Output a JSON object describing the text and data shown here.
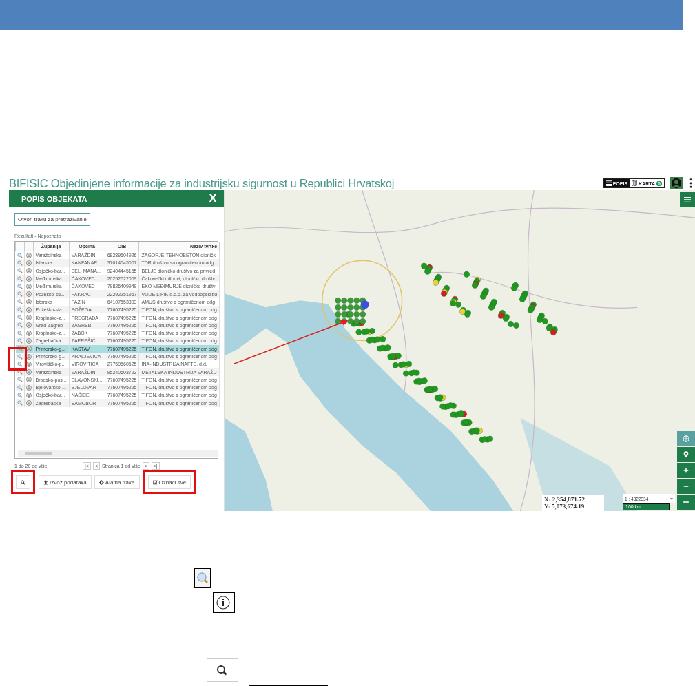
{
  "app": {
    "title": "BIFISIC Objedinjene informacije za industrijsku sigurnost u Republici Hrvatskoj",
    "view_toggle": [
      {
        "label": "POPIS",
        "selected": true
      },
      {
        "label": "KARTA",
        "selected": false,
        "badge": "0"
      }
    ]
  },
  "panel": {
    "title": "POPIS OBJEKATA",
    "close": "X",
    "search_toggle": "Otvori traku za pretraživanje",
    "results_label": "Rezultati - Nepoznato",
    "columns": [
      "Županija",
      "Općina",
      "OIB",
      "Naziv tvrtke"
    ],
    "rows": [
      {
        "zupanija": "Varaždinska",
        "opcina": "VARAŽDIN",
        "oib": "68289504926",
        "naziv": "ZAGORJE-TEHNOBETON dioničk",
        "selected": false
      },
      {
        "zupanija": "Istarska",
        "opcina": "KANFANAR",
        "oib": "37014645007",
        "naziv": "TDR društvo sa ograničenom odg",
        "selected": false
      },
      {
        "zupanija": "Osječko-bar...",
        "opcina": "BELI MANA...",
        "oib": "92404445155",
        "naziv": "BELJE dioničko društvo za privred",
        "selected": false
      },
      {
        "zupanija": "Međimurska",
        "opcina": "ČAKOVEC",
        "oib": "20252622069",
        "naziv": "Čakovečki mlinovi, dioničko društv",
        "selected": false
      },
      {
        "zupanija": "Međimurska",
        "opcina": "ČAKOVEC",
        "oib": "79826409949",
        "naziv": "EKO MEĐIMURJE dioničko društv",
        "selected": false
      },
      {
        "zupanija": "Požeško-sla...",
        "opcina": "PAKRAC",
        "oib": "22292251967",
        "naziv": "VODE LIPIK d.o.o. za vodoopskrbu",
        "selected": false
      },
      {
        "zupanija": "Istarska",
        "opcina": "PAZIN",
        "oib": "64107553803",
        "naziv": "AMUS društvo s ograničenom odg",
        "selected": false
      },
      {
        "zupanija": "Požeško-sla...",
        "opcina": "POŽEGA",
        "oib": "77607495225",
        "naziv": "TIFON, društvo s ograničenom odg",
        "selected": false
      },
      {
        "zupanija": "Krapinsko-z...",
        "opcina": "PREGRADA",
        "oib": "77607495225",
        "naziv": "TIFON, društvo s ograničenom odg",
        "selected": false
      },
      {
        "zupanija": "Grad Zagreb",
        "opcina": "ZAGREB",
        "oib": "77607495225",
        "naziv": "TIFON, društvo s ograničenom odg",
        "selected": false
      },
      {
        "zupanija": "Krapinsko-z...",
        "opcina": "ZABOK",
        "oib": "77607495225",
        "naziv": "TIFON, društvo s ograničenom odg",
        "selected": false
      },
      {
        "zupanija": "Zagrebačka",
        "opcina": "ZAPREŠIĆ",
        "oib": "77607495225",
        "naziv": "TIFON, društvo s ograničenom odg",
        "selected": false
      },
      {
        "zupanija": "Primorsko-g...",
        "opcina": "KASTAV",
        "oib": "77607495225",
        "naziv": "TIFON, društvo s ograničenom odg",
        "selected": true
      },
      {
        "zupanija": "Primorsko-g...",
        "opcina": "KRALJEVICA",
        "oib": "77607495225",
        "naziv": "TIFON, društvo s ograničenom odg",
        "selected": false
      },
      {
        "zupanija": "Virovitičko-p...",
        "opcina": "VIROVITICA",
        "oib": "27759560625",
        "naziv": "INA-INDUSTRIJA NAFTE, d.d.",
        "selected": false
      },
      {
        "zupanija": "Varaždinska",
        "opcina": "VARAŽDIN",
        "oib": "95240603723",
        "naziv": "METALSKA INDUSTRIJA VARAŽD",
        "selected": false
      },
      {
        "zupanija": "Brodsko-pos...",
        "opcina": "SLAVONSKI...",
        "oib": "77607495225",
        "naziv": "TIFON, društvo s ograničenom odg",
        "selected": false
      },
      {
        "zupanija": "Bjelovarsko-...",
        "opcina": "BJELOVAR",
        "oib": "77607495225",
        "naziv": "TIFON, društvo s ograničenom odg",
        "selected": false
      },
      {
        "zupanija": "Osječko-bar...",
        "opcina": "NAŠICE",
        "oib": "77607495225",
        "naziv": "TIFON, društvo s ograničenom odg",
        "selected": false
      },
      {
        "zupanija": "Zagrebačka",
        "opcina": "SAMOBOR",
        "oib": "77607495225",
        "naziv": "TIFON, društvo s ograničenom odg",
        "selected": false
      }
    ],
    "pager": {
      "summary": "1 do 20 od više",
      "first": "|<",
      "prev": "<",
      "page": "Stranica 1 od više",
      "next": ">",
      "last": ">|"
    },
    "buttons": [
      {
        "kind": "search"
      },
      {
        "kind": "export",
        "label": "Izvoz podataka"
      },
      {
        "kind": "toolbar",
        "label": "Alatna traka"
      },
      {
        "kind": "select_all",
        "label": "Označi sve"
      }
    ]
  },
  "map": {
    "coordinates": [
      "X: 2,354,871.72",
      "Y: 5,073,674.19"
    ],
    "scale": "1 : 4822334",
    "scale_bar": "100 km"
  }
}
